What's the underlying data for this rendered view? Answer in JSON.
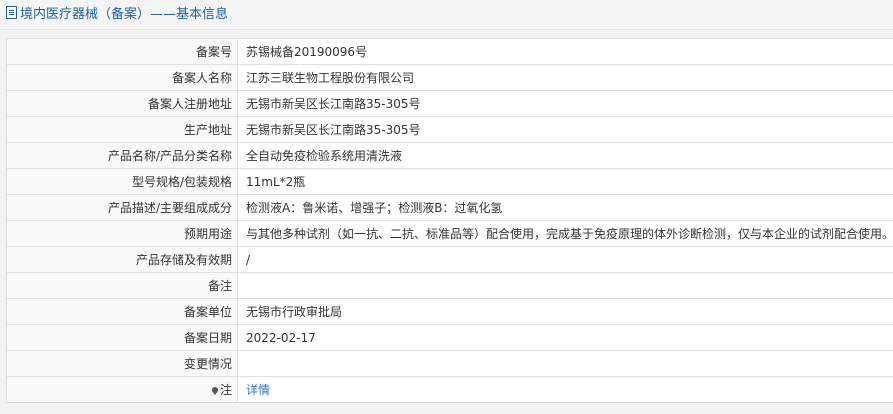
{
  "header": {
    "title": "境内医疗器械（备案）",
    "subtitle": "——基本信息"
  },
  "rows": [
    {
      "label": "备案号",
      "value": "苏锡械备20190096号"
    },
    {
      "label": "备案人名称",
      "value": "江苏三联生物工程股份有限公司"
    },
    {
      "label": "备案人注册地址",
      "value": "无锡市新吴区长江南路35-305号"
    },
    {
      "label": "生产地址",
      "value": "无锡市新吴区长江南路35-305号"
    },
    {
      "label": "产品名称/产品分类名称",
      "value": "全自动免疫检验系统用清洗液"
    },
    {
      "label": "型号规格/包装规格",
      "value": "11mL*2瓶"
    },
    {
      "label": "产品描述/主要组成成分",
      "value": "检测液A：鲁米诺、增强子；检测液B：过氧化氢"
    },
    {
      "label": "预期用途",
      "value": "与其他多种试剂（如一抗、二抗、标准品等）配合使用，完成基于免疫原理的体外诊断检测，仅与本企业的试剂配合使用。"
    },
    {
      "label": "产品存储及有效期",
      "value": "/"
    },
    {
      "label": "备注",
      "value": ""
    },
    {
      "label": "备案单位",
      "value": "无锡市行政审批局"
    },
    {
      "label": "备案日期",
      "value": "2022-02-17"
    },
    {
      "label": "变更情况",
      "value": ""
    }
  ],
  "note": {
    "label": "注",
    "icon": "pin-icon",
    "link_text": "详情"
  }
}
